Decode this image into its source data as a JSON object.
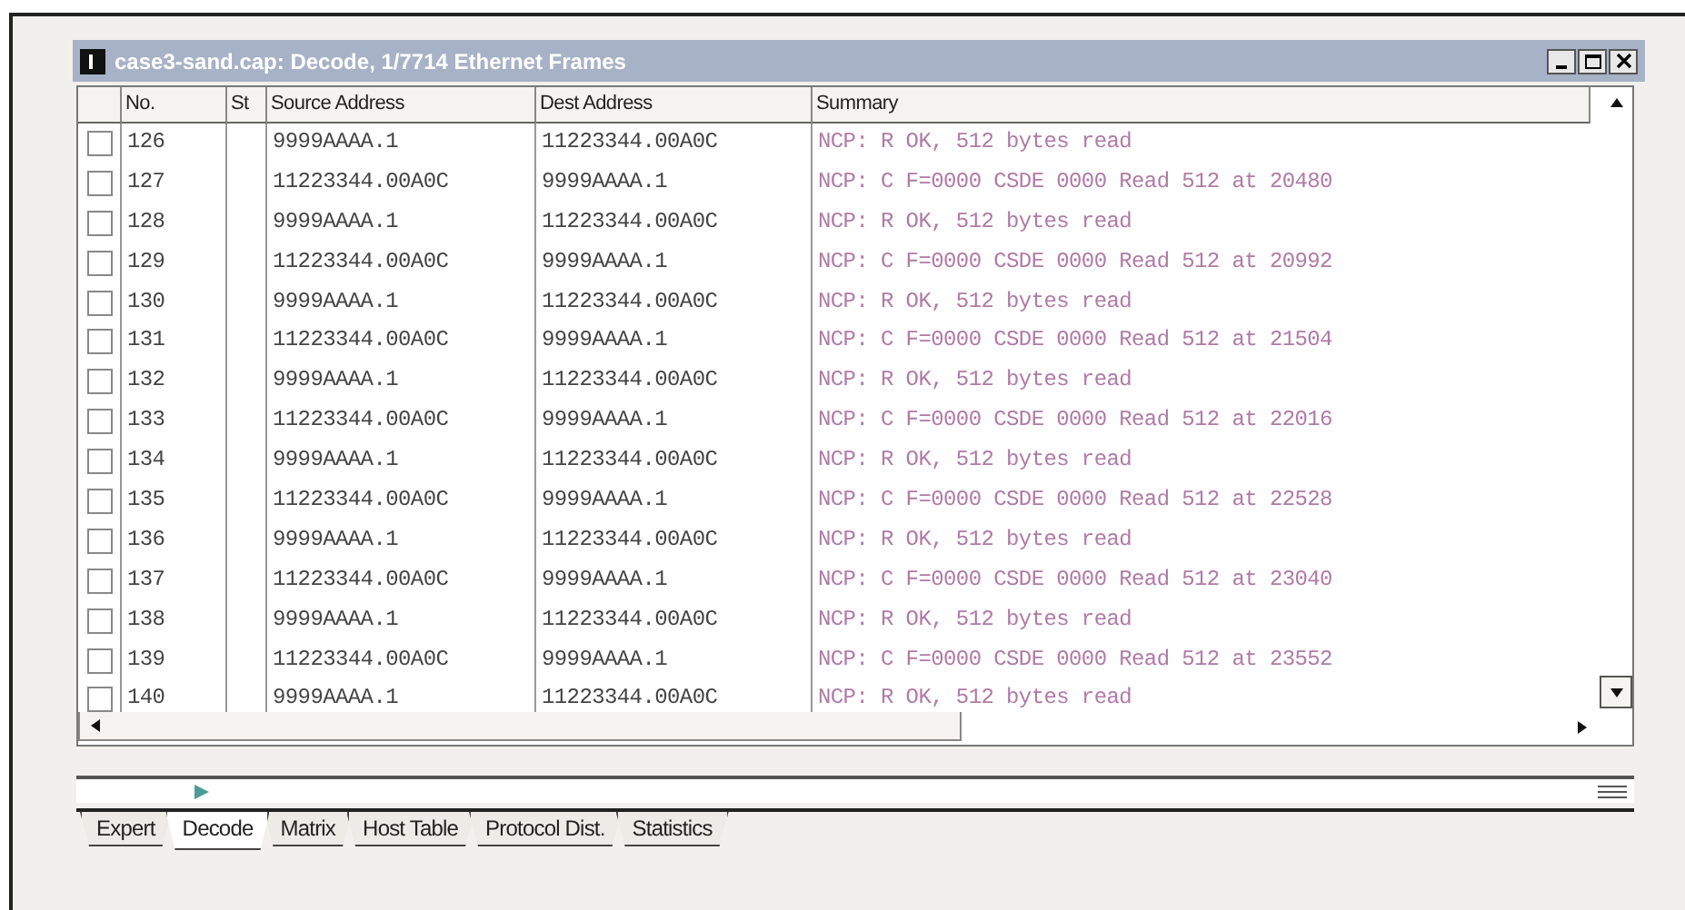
{
  "window": {
    "title": "case3-sand.cap: Decode, 1/7714 Ethernet Frames"
  },
  "table": {
    "columns": [
      "No.",
      "St",
      "Source Address",
      "Dest Address",
      "Summary"
    ],
    "rows": [
      {
        "checked": false,
        "cells": [
          "126",
          "",
          "9999AAAA.1",
          "11223344.00A0C",
          "NCP: R OK, 512 bytes read"
        ]
      },
      {
        "checked": false,
        "cells": [
          "127",
          "",
          "11223344.00A0C",
          "9999AAAA.1",
          "NCP: C F=0000 CSDE 0000 Read 512 at 20480"
        ]
      },
      {
        "checked": false,
        "cells": [
          "128",
          "",
          "9999AAAA.1",
          "11223344.00A0C",
          "NCP: R OK, 512 bytes read"
        ]
      },
      {
        "checked": false,
        "cells": [
          "129",
          "",
          "11223344.00A0C",
          "9999AAAA.1",
          "NCP: C F=0000 CSDE 0000 Read 512 at 20992"
        ]
      },
      {
        "checked": false,
        "cells": [
          "130",
          "",
          "9999AAAA.1",
          "11223344.00A0C",
          "NCP: R OK, 512 bytes read"
        ]
      },
      {
        "checked": false,
        "cells": [
          "131",
          "",
          "11223344.00A0C",
          "9999AAAA.1",
          "NCP: C F=0000 CSDE 0000 Read 512 at 21504"
        ]
      },
      {
        "checked": false,
        "cells": [
          "132",
          "",
          "9999AAAA.1",
          "11223344.00A0C",
          "NCP: R OK, 512 bytes read"
        ]
      },
      {
        "checked": false,
        "cells": [
          "133",
          "",
          "11223344.00A0C",
          "9999AAAA.1",
          "NCP: C F=0000 CSDE 0000 Read 512 at 22016"
        ]
      },
      {
        "checked": false,
        "cells": [
          "134",
          "",
          "9999AAAA.1",
          "11223344.00A0C",
          "NCP: R OK, 512 bytes read"
        ]
      },
      {
        "checked": false,
        "cells": [
          "135",
          "",
          "11223344.00A0C",
          "9999AAAA.1",
          "NCP: C F=0000 CSDE 0000 Read 512 at 22528"
        ]
      },
      {
        "checked": false,
        "cells": [
          "136",
          "",
          "9999AAAA.1",
          "11223344.00A0C",
          "NCP: R OK, 512 bytes read"
        ]
      },
      {
        "checked": false,
        "cells": [
          "137",
          "",
          "11223344.00A0C",
          "9999AAAA.1",
          "NCP: C F=0000 CSDE 0000 Read 512 at 23040"
        ]
      },
      {
        "checked": false,
        "cells": [
          "138",
          "",
          "9999AAAA.1",
          "11223344.00A0C",
          "NCP: R OK, 512 bytes read"
        ]
      },
      {
        "checked": false,
        "cells": [
          "139",
          "",
          "11223344.00A0C",
          "9999AAAA.1",
          "NCP: C F=0000 CSDE 0000 Read 512 at 23552"
        ]
      },
      {
        "checked": false,
        "cells": [
          "140",
          "",
          "9999AAAA.1",
          "11223344.00A0C",
          "NCP: R OK, 512 bytes read"
        ]
      }
    ]
  },
  "tabs": [
    {
      "label": "Expert",
      "selected": false
    },
    {
      "label": "Decode",
      "selected": true
    },
    {
      "label": "Matrix",
      "selected": false
    },
    {
      "label": "Host Table",
      "selected": false
    },
    {
      "label": "Protocol Dist.",
      "selected": false
    },
    {
      "label": "Statistics",
      "selected": false
    }
  ]
}
